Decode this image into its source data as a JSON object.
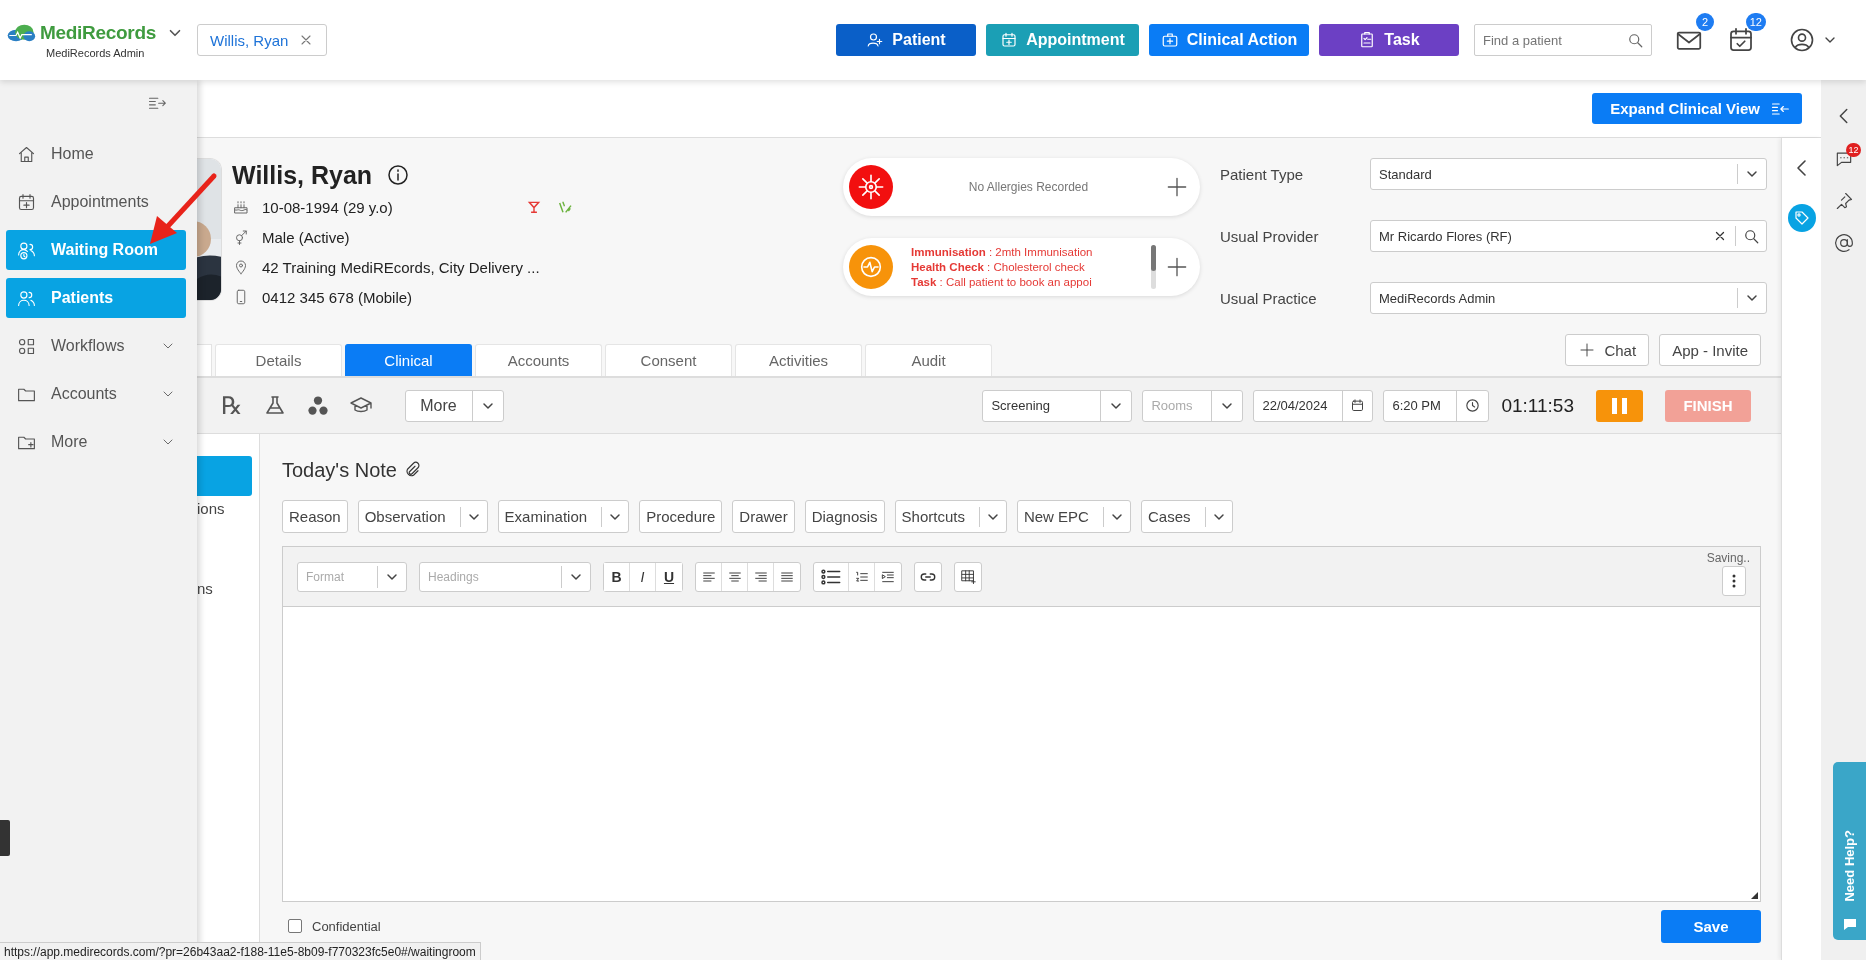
{
  "brand": {
    "name": "MediRecords",
    "subtitle": "MediRecords Admin"
  },
  "patient_tab": {
    "label": "Willis, Ryan"
  },
  "quick_actions": [
    {
      "label": "Patient",
      "color": "#0a5fc8"
    },
    {
      "label": "Appointment",
      "color": "#1b9fb5"
    },
    {
      "label": "Clinical Action",
      "color": "#0a7cf5"
    },
    {
      "label": "Task",
      "color": "#6c40c4"
    }
  ],
  "search": {
    "placeholder": "Find a patient"
  },
  "notifications": [
    {
      "kind": "mail",
      "count": "2"
    },
    {
      "kind": "calendar",
      "count": "12"
    }
  ],
  "sidebar": {
    "items": [
      {
        "label": "Home",
        "selected": false,
        "expandable": false
      },
      {
        "label": "Appointments",
        "selected": false,
        "expandable": false
      },
      {
        "label": "Waiting Room",
        "selected": true,
        "expandable": false
      },
      {
        "label": "Patients",
        "selected": true,
        "expandable": false
      },
      {
        "label": "Workflows",
        "selected": false,
        "expandable": true
      },
      {
        "label": "Accounts",
        "selected": false,
        "expandable": true
      },
      {
        "label": "More",
        "selected": false,
        "expandable": true
      }
    ]
  },
  "expand_button": {
    "label": "Expand Clinical View"
  },
  "patient": {
    "name": "Willis, Ryan",
    "details": [
      {
        "kind": "dob",
        "text": "10-08-1994 (29 y.o)"
      },
      {
        "kind": "gender",
        "text": "Male (Active)"
      },
      {
        "kind": "address",
        "text": "42 Training MediREcords, City Delivery ..."
      },
      {
        "kind": "phone",
        "text": "0412 345 678 (Mobile)"
      }
    ]
  },
  "allergies": {
    "text": "No Allergies Recorded"
  },
  "reminders": [
    {
      "text": "**Immunisation** : 2mth Immunisation"
    },
    {
      "text": "**Health Check** : Cholesterol check"
    },
    {
      "text": "**Task** : Call patient to book an appoi"
    }
  ],
  "patient_fields": [
    {
      "label": "Patient Type",
      "value": "Standard",
      "kind": "select"
    },
    {
      "label": "Usual Provider",
      "value": "Mr Ricardo Flores (RF)",
      "kind": "lookup"
    },
    {
      "label": "Usual Practice",
      "value": "MediRecords Admin",
      "kind": "select"
    }
  ],
  "record_tabs": [
    {
      "label": "Details",
      "selected": false
    },
    {
      "label": "Clinical",
      "selected": true
    },
    {
      "label": "Accounts",
      "selected": false
    },
    {
      "label": "Consent",
      "selected": false
    },
    {
      "label": "Activities",
      "selected": false
    },
    {
      "label": "Audit",
      "selected": false
    }
  ],
  "header_buttons": [
    {
      "label": "Chat",
      "kind": "add"
    },
    {
      "label": "App - Invite",
      "kind": "plain"
    }
  ],
  "encounter": {
    "rx_glyph": "℞",
    "more": "More",
    "type": "Screening",
    "room_placeholder": "Rooms",
    "date": "22/04/2024",
    "time": "6:20 PM",
    "timer": "01:11:53",
    "finish": {
      "label": "FINISH",
      "disabled": true
    }
  },
  "side_nav": [
    {
      "selected": true
    },
    {
      "text": "ions",
      "selected": false
    },
    {
      "text": "ns",
      "selected": false
    }
  ],
  "note": {
    "title": "Today's Note",
    "sections": [
      {
        "label": "Reason",
        "dropdown": false
      },
      {
        "label": "Observation",
        "dropdown": true
      },
      {
        "label": "Examination",
        "dropdown": true
      },
      {
        "label": "Procedure",
        "dropdown": false
      },
      {
        "label": "Drawer",
        "dropdown": false
      },
      {
        "label": "Diagnosis",
        "dropdown": false
      },
      {
        "label": "Shortcuts",
        "dropdown": true
      },
      {
        "label": "New EPC",
        "dropdown": true
      },
      {
        "label": "Cases",
        "dropdown": true
      }
    ],
    "format_placeholder": "Format",
    "headings_placeholder": "Headings",
    "format_buttons": [
      {
        "label": "B",
        "kind": "bold"
      },
      {
        "label": "I",
        "kind": "italic"
      },
      {
        "label": "U",
        "kind": "underline"
      }
    ],
    "status": "Saving..",
    "confidential": {
      "label": "Confidential",
      "checked": false
    },
    "save": "Save"
  },
  "right_rail": {
    "chat_count": "12"
  },
  "help_tab": "Need Help?",
  "status_url": "https://app.medirecords.com/?pr=26b43aa2-f188-11e5-8b09-f770323fc5e0#/waitingroom"
}
